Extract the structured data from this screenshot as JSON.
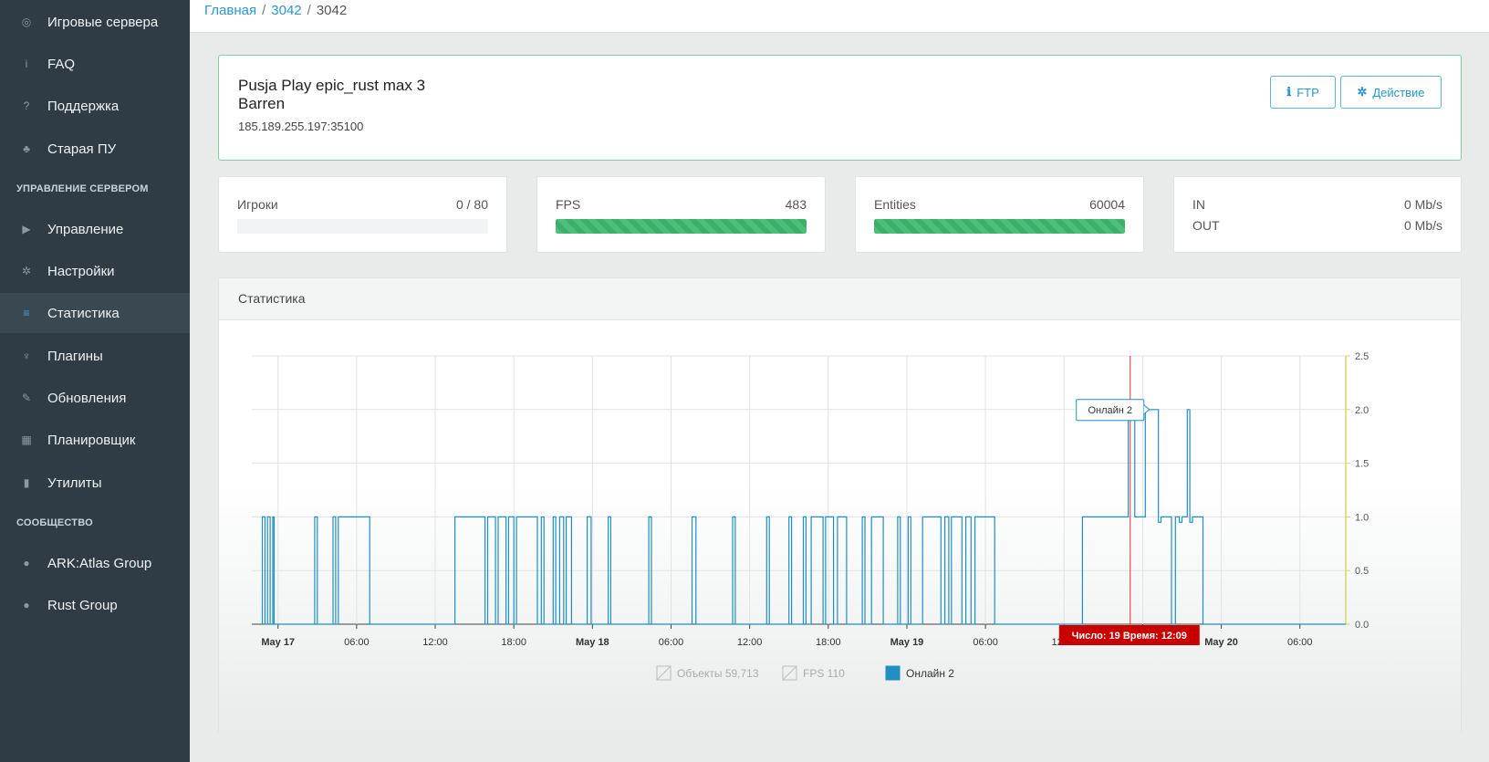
{
  "sidebar": {
    "items": [
      {
        "label": "Игровые сервера",
        "icon": "gamepad-icon",
        "glyph": "◎"
      },
      {
        "label": "FAQ",
        "icon": "info-icon",
        "glyph": "i"
      },
      {
        "label": "Поддержка",
        "icon": "question-icon",
        "glyph": "?"
      },
      {
        "label": "Старая ПУ",
        "icon": "cubes-icon",
        "glyph": "♣"
      },
      {
        "label": "Управление",
        "icon": "play-icon",
        "glyph": "▶"
      },
      {
        "label": "Настройки",
        "icon": "gear-icon",
        "glyph": "✲"
      },
      {
        "label": "Статистика",
        "icon": "database-icon",
        "glyph": "≡"
      },
      {
        "label": "Плагины",
        "icon": "plug-icon",
        "glyph": "♆"
      },
      {
        "label": "Обновления",
        "icon": "wrench-icon",
        "glyph": "✎"
      },
      {
        "label": "Планировщик",
        "icon": "calendar-icon",
        "glyph": "▦"
      },
      {
        "label": "Утилиты",
        "icon": "file-icon",
        "glyph": "▮"
      },
      {
        "label": "ARK:Atlas Group",
        "icon": "steam-icon",
        "glyph": "●"
      },
      {
        "label": "Rust Group",
        "icon": "steam-icon",
        "glyph": "●"
      }
    ],
    "section_server": "УПРАВЛЕНИЕ СЕРВЕРОМ",
    "section_community": "СООБЩЕСТВО"
  },
  "breadcrumb": {
    "home": "Главная",
    "parent": "3042",
    "current": "3042",
    "sep": "/"
  },
  "server": {
    "name": "Pusja Play epic_rust max 3",
    "map": "Barren",
    "address": "185.189.255.197:35100",
    "ftp_label": "FTP",
    "action_label": "Действие"
  },
  "stats": {
    "players": {
      "label": "Игроки",
      "value": "0 / 80",
      "fill": 0
    },
    "fps": {
      "label": "FPS",
      "value": "483",
      "fill": 1
    },
    "entities": {
      "label": "Entities",
      "value": "60004",
      "fill": 1
    },
    "net_in": {
      "label": "IN",
      "value": "0 Mb/s"
    },
    "net_out": {
      "label": "OUT",
      "value": "0 Mb/s"
    }
  },
  "panel": {
    "title": "Статистика"
  },
  "chart_data": {
    "type": "line",
    "x_ticks": [
      "May 17",
      "06:00",
      "12:00",
      "18:00",
      "May 18",
      "06:00",
      "12:00",
      "18:00",
      "May 19",
      "06:00",
      "12:00",
      "18:00",
      "May 20",
      "06:00"
    ],
    "x_ticks_bold": [
      true,
      false,
      false,
      false,
      true,
      false,
      false,
      false,
      true,
      false,
      false,
      false,
      true,
      false
    ],
    "x_range_hours": [
      -2,
      81.5
    ],
    "y_ticks": [
      "0.0",
      "0.5",
      "1.0",
      "1.5",
      "2.0",
      "2.5"
    ],
    "ylim": [
      0,
      2.5
    ],
    "series": [
      {
        "name": "Онлайн 2",
        "color": "#1f8fc4",
        "visible": true,
        "points": [
          [
            -1.2,
            0
          ],
          [
            -1.2,
            1
          ],
          [
            -1.0,
            1
          ],
          [
            -1.0,
            0
          ],
          [
            -0.8,
            0
          ],
          [
            -0.8,
            1
          ],
          [
            -0.6,
            1
          ],
          [
            -0.6,
            0
          ],
          [
            -0.4,
            0
          ],
          [
            -0.4,
            1
          ],
          [
            -0.3,
            1
          ],
          [
            -0.3,
            0
          ],
          [
            2.8,
            0
          ],
          [
            2.8,
            1
          ],
          [
            3.0,
            1
          ],
          [
            3.0,
            0
          ],
          [
            4.2,
            0
          ],
          [
            4.2,
            1
          ],
          [
            4.4,
            1
          ],
          [
            4.4,
            0
          ],
          [
            4.6,
            0
          ],
          [
            4.6,
            1
          ],
          [
            7.0,
            1
          ],
          [
            7.0,
            0
          ],
          [
            13.5,
            0
          ],
          [
            13.5,
            1
          ],
          [
            15.8,
            1
          ],
          [
            15.8,
            0
          ],
          [
            16.0,
            0
          ],
          [
            16.0,
            1
          ],
          [
            16.6,
            1
          ],
          [
            16.6,
            0
          ],
          [
            16.8,
            0
          ],
          [
            16.8,
            1
          ],
          [
            17.4,
            1
          ],
          [
            17.4,
            0
          ],
          [
            17.6,
            0
          ],
          [
            17.6,
            1
          ],
          [
            18.0,
            1
          ],
          [
            18.0,
            0
          ],
          [
            18.2,
            0
          ],
          [
            18.2,
            1
          ],
          [
            19.8,
            1
          ],
          [
            19.8,
            0
          ],
          [
            20.1,
            0
          ],
          [
            20.1,
            1
          ],
          [
            20.3,
            1
          ],
          [
            20.3,
            0
          ],
          [
            21.0,
            0
          ],
          [
            21.0,
            1
          ],
          [
            21.2,
            1
          ],
          [
            21.2,
            0
          ],
          [
            21.5,
            0
          ],
          [
            21.5,
            1
          ],
          [
            21.8,
            1
          ],
          [
            21.8,
            0
          ],
          [
            22.0,
            0
          ],
          [
            22.0,
            1
          ],
          [
            22.4,
            1
          ],
          [
            22.4,
            0
          ],
          [
            23.6,
            0
          ],
          [
            23.6,
            1
          ],
          [
            23.9,
            1
          ],
          [
            23.9,
            0
          ],
          [
            25.2,
            0
          ],
          [
            25.2,
            1
          ],
          [
            25.4,
            1
          ],
          [
            25.4,
            0
          ],
          [
            28.3,
            0
          ],
          [
            28.3,
            1
          ],
          [
            28.5,
            1
          ],
          [
            28.5,
            0
          ],
          [
            31.6,
            0
          ],
          [
            31.6,
            1
          ],
          [
            31.9,
            1
          ],
          [
            31.9,
            0
          ],
          [
            34.7,
            0
          ],
          [
            34.7,
            1
          ],
          [
            34.9,
            1
          ],
          [
            34.9,
            0
          ],
          [
            37.3,
            0
          ],
          [
            37.3,
            1
          ],
          [
            37.5,
            1
          ],
          [
            37.5,
            0
          ],
          [
            39.0,
            0
          ],
          [
            39.0,
            1
          ],
          [
            39.2,
            1
          ],
          [
            39.2,
            0
          ],
          [
            40.1,
            0
          ],
          [
            40.1,
            1
          ],
          [
            40.3,
            1
          ],
          [
            40.3,
            0
          ],
          [
            40.7,
            0
          ],
          [
            40.7,
            1
          ],
          [
            41.6,
            1
          ],
          [
            41.6,
            0
          ],
          [
            41.8,
            0
          ],
          [
            41.8,
            1
          ],
          [
            42.4,
            1
          ],
          [
            42.4,
            0
          ],
          [
            42.7,
            0
          ],
          [
            42.7,
            1
          ],
          [
            43.4,
            1
          ],
          [
            43.4,
            0
          ],
          [
            44.6,
            0
          ],
          [
            44.6,
            1
          ],
          [
            44.8,
            1
          ],
          [
            44.8,
            0
          ],
          [
            45.3,
            0
          ],
          [
            45.3,
            1
          ],
          [
            46.2,
            1
          ],
          [
            46.2,
            0
          ],
          [
            47.3,
            0
          ],
          [
            47.3,
            1
          ],
          [
            47.5,
            1
          ],
          [
            47.5,
            0
          ],
          [
            48.1,
            0
          ],
          [
            48.1,
            1
          ],
          [
            48.3,
            1
          ],
          [
            48.3,
            0
          ],
          [
            49.2,
            0
          ],
          [
            49.2,
            1
          ],
          [
            50.6,
            1
          ],
          [
            50.6,
            0
          ],
          [
            50.9,
            0
          ],
          [
            50.9,
            1
          ],
          [
            51.2,
            1
          ],
          [
            51.2,
            0
          ],
          [
            51.4,
            0
          ],
          [
            51.4,
            1
          ],
          [
            52.2,
            1
          ],
          [
            52.2,
            0
          ],
          [
            52.5,
            0
          ],
          [
            52.5,
            1
          ],
          [
            52.9,
            1
          ],
          [
            52.9,
            0
          ],
          [
            53.2,
            0
          ],
          [
            53.2,
            1
          ],
          [
            54.7,
            1
          ],
          [
            54.7,
            0
          ],
          [
            61.4,
            0
          ],
          [
            61.4,
            1
          ],
          [
            64.9,
            1
          ],
          [
            64.9,
            2
          ],
          [
            65.4,
            2
          ],
          [
            65.4,
            1
          ],
          [
            66.2,
            1
          ],
          [
            66.2,
            2
          ],
          [
            67.2,
            2
          ],
          [
            67.2,
            0.95
          ],
          [
            67.4,
            0.95
          ],
          [
            67.4,
            1
          ],
          [
            68.2,
            1
          ],
          [
            68.2,
            0
          ],
          [
            68.5,
            0
          ],
          [
            68.5,
            1
          ],
          [
            68.8,
            1
          ],
          [
            68.8,
            0.95
          ],
          [
            69.0,
            0.95
          ],
          [
            69.0,
            1
          ],
          [
            69.4,
            1
          ],
          [
            69.4,
            2
          ],
          [
            69.6,
            2
          ],
          [
            69.6,
            0.95
          ],
          [
            69.8,
            0.95
          ],
          [
            69.8,
            1
          ],
          [
            70.6,
            1
          ],
          [
            70.6,
            0
          ],
          [
            81.5,
            0
          ]
        ]
      }
    ],
    "tooltip": {
      "label": "Онлайн 2",
      "x": 66.3,
      "y": 2.0
    },
    "crosshair": {
      "x": 65.05,
      "label": "Число: 19 Время: 12:09"
    },
    "legend": [
      {
        "label": "Объекты",
        "value": "59,713",
        "enabled": false,
        "color": "#cccccc"
      },
      {
        "label": "FPS",
        "value": "110",
        "enabled": false,
        "color": "#cccccc"
      },
      {
        "label": "Онлайн",
        "value": "2",
        "enabled": true,
        "color": "#1f8fc4"
      }
    ],
    "legend_position": "bottom-center",
    "grid": true
  }
}
